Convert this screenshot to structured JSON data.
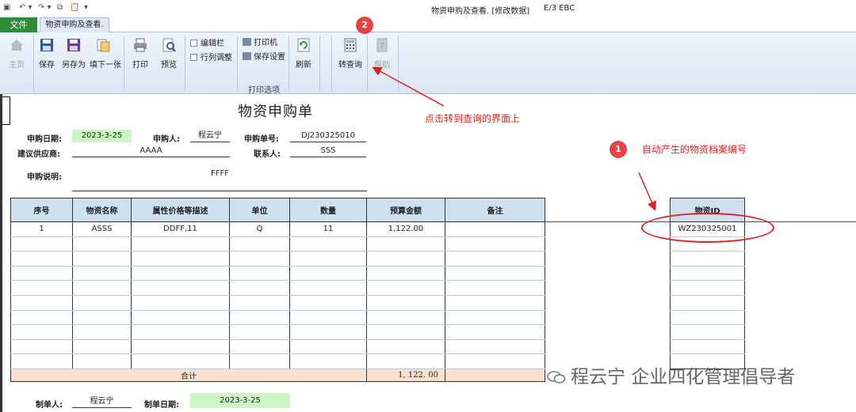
{
  "titlebar": {
    "window_title": "物资申购及查看. [修改数据]",
    "app_name": "E/3 EBC"
  },
  "tabs": [
    {
      "label": "文件"
    },
    {
      "label": "物资申购及查看."
    }
  ],
  "ribbon": {
    "home": "主页",
    "save": "保存",
    "save_as": "另存为",
    "fill_next": "填下一张",
    "print": "打印",
    "preview": "预览",
    "edit_bar": "编辑栏",
    "row_col_adjust": "行列调整",
    "printer": "打印机",
    "save_settings": "保存设置",
    "print_options": "打印选项",
    "refresh": "刷新",
    "to_query": "转查询",
    "help": "帮助"
  },
  "form": {
    "title": "物资申购单",
    "apply_date_label": "申购日期:",
    "apply_date": "2023-3-25",
    "applicant_label": "申购人:",
    "applicant": "程云宁",
    "order_no_label": "申购单号:",
    "order_no": "DJ230325010",
    "supplier_label": "建议供应商:",
    "supplier": "AAAA",
    "contact_label": "联系人:",
    "contact": "SSS",
    "desc_label": "申购说明:",
    "desc": "FFFF",
    "maker_label": "制单人:",
    "maker": "程云宁",
    "make_date_label": "制单日期:",
    "make_date": "2023-3-25"
  },
  "table": {
    "headers": [
      "序号",
      "物资名称",
      "属性价格等描述",
      "单位",
      "数量",
      "预算金额",
      "备注"
    ],
    "rows": [
      [
        "1",
        "ASSS",
        "DDFF,11",
        "Q",
        "11",
        "1,122.00",
        ""
      ]
    ],
    "total_label": "合计",
    "total_amount": "1, 122. 00"
  },
  "id_table": {
    "header": "物资ID",
    "value": "WZ230325001"
  },
  "annotations": {
    "badge1": "1",
    "badge2": "2",
    "note1": "自动产生的物资档案编号",
    "note2": "点击转到查询的界面上"
  },
  "watermark": "程云宁 企业四化管理倡导者",
  "colors": {
    "file_tab": "#2f8a3a",
    "header_bg": "#cfe0f1",
    "total_bg": "#fbe1d2",
    "date_bg": "#ccf5c4",
    "annotation_red": "#e02020"
  }
}
